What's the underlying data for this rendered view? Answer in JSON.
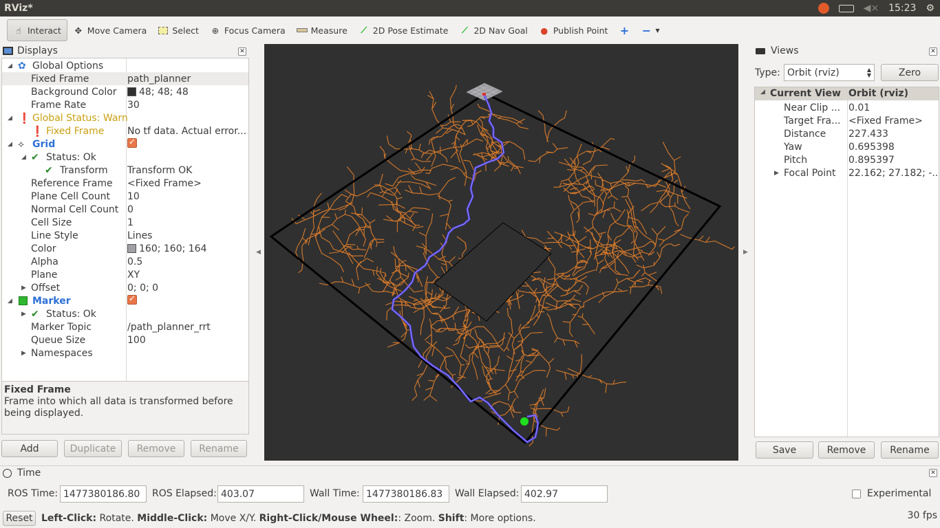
{
  "window": {
    "title": "RViz*",
    "clock": "15:23"
  },
  "toolbar": {
    "interact": "Interact",
    "move_camera": "Move Camera",
    "select": "Select",
    "focus_camera": "Focus Camera",
    "measure": "Measure",
    "pose_estimate": "2D Pose Estimate",
    "nav_goal": "2D Nav Goal",
    "publish_point": "Publish Point"
  },
  "displays": {
    "title": "Displays",
    "rows": [
      {
        "key": "Global Options",
        "value": ""
      },
      {
        "key": "Fixed Frame",
        "value": "path_planner"
      },
      {
        "key": "Background Color",
        "value": "48; 48; 48"
      },
      {
        "key": "Frame Rate",
        "value": "30"
      },
      {
        "key": "Global Status: Warn",
        "value": ""
      },
      {
        "key": "Fixed Frame",
        "value": "No tf data.  Actual error..."
      },
      {
        "key": "Grid",
        "value": ""
      },
      {
        "key": "Status: Ok",
        "value": ""
      },
      {
        "key": "Transform",
        "value": "Transform OK"
      },
      {
        "key": "Reference Frame",
        "value": "<Fixed Frame>"
      },
      {
        "key": "Plane Cell Count",
        "value": "10"
      },
      {
        "key": "Normal Cell Count",
        "value": "0"
      },
      {
        "key": "Cell Size",
        "value": "1"
      },
      {
        "key": "Line Style",
        "value": "Lines"
      },
      {
        "key": "Color",
        "value": "160; 160; 164"
      },
      {
        "key": "Alpha",
        "value": "0.5"
      },
      {
        "key": "Plane",
        "value": "XY"
      },
      {
        "key": "Offset",
        "value": "0; 0; 0"
      },
      {
        "key": "Marker",
        "value": ""
      },
      {
        "key": "Status: Ok",
        "value": ""
      },
      {
        "key": "Marker Topic",
        "value": "/path_planner_rrt"
      },
      {
        "key": "Queue Size",
        "value": "100"
      },
      {
        "key": "Namespaces",
        "value": ""
      }
    ],
    "desc_title": "Fixed Frame",
    "desc_text": "Frame into which all data is transformed before being displayed.",
    "buttons": {
      "add": "Add",
      "duplicate": "Duplicate",
      "remove": "Remove",
      "rename": "Rename"
    },
    "colors": {
      "background": "#303030",
      "grid": "#a0a0a4"
    }
  },
  "views": {
    "title": "Views",
    "type_label": "Type:",
    "type_value": "Orbit (rviz)",
    "zero": "Zero",
    "head_key": "Current View",
    "head_value": "Orbit (rviz)",
    "rows": [
      {
        "key": "Near Clip ...",
        "value": "0.01"
      },
      {
        "key": "Target Fra...",
        "value": "<Fixed Frame>"
      },
      {
        "key": "Distance",
        "value": "227.433"
      },
      {
        "key": "Yaw",
        "value": "0.695398"
      },
      {
        "key": "Pitch",
        "value": "0.895397"
      },
      {
        "key": "Focal Point",
        "value": "22.162; 27.182; -..."
      }
    ],
    "buttons": {
      "save": "Save",
      "remove": "Remove",
      "rename": "Rename"
    }
  },
  "time": {
    "title": "Time",
    "ros_time_label": "ROS Time:",
    "ros_time": "1477380186.80",
    "ros_elapsed_label": "ROS Elapsed:",
    "ros_elapsed": "403.07",
    "wall_time_label": "Wall Time:",
    "wall_time": "1477380186.83",
    "wall_elapsed_label": "Wall Elapsed:",
    "wall_elapsed": "402.97",
    "experimental": "Experimental"
  },
  "status": {
    "reset": "Reset",
    "left_click": "Left-Click:",
    "left_click_text": " Rotate. ",
    "middle_click": "Middle-Click:",
    "middle_click_text": " Move X/Y. ",
    "right_click": "Right-Click/Mouse Wheel:",
    "right_click_text": ": Zoom. ",
    "shift": "Shift",
    "shift_text": ": More options.",
    "fps": "30 fps"
  }
}
